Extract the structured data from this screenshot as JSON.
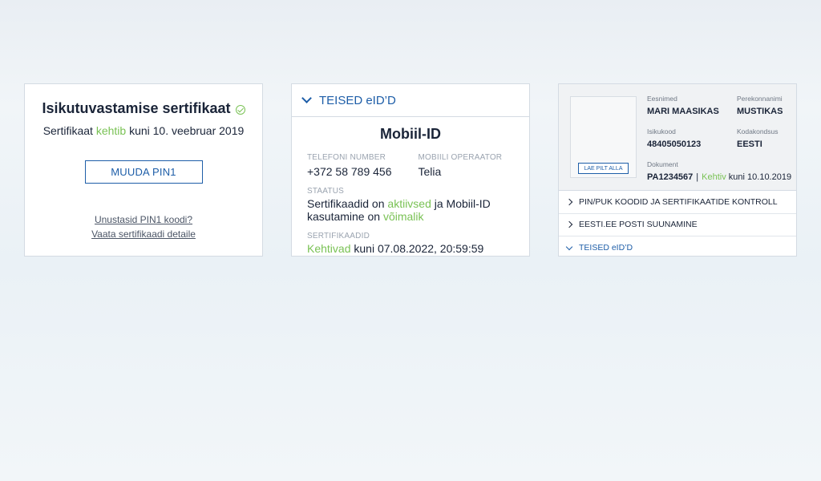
{
  "cert_card": {
    "title": "Isikutuvastamise sertifikaat",
    "status_prefix": "Sertifikaat",
    "status_word": "kehtib",
    "status_suffix": "kuni 10. veebruar 2019",
    "change_pin_button": "MUUDA PIN1",
    "forgot_pin_link": "Unustasid PIN1 koodi?",
    "details_link": "Vaata sertifikaadi detaile"
  },
  "mobile_card": {
    "header": "TEISED eID’D",
    "title": "Mobiil-ID",
    "phone_label": "TELEFONI NUMBER",
    "phone_value": "+372 58 789 456",
    "operator_label": "MOBIILI OPERAATOR",
    "operator_value": "Telia",
    "status_label": "STAATUS",
    "status_text_1": "Sertifikaadid on",
    "status_word_1": "aktiivsed",
    "status_text_2": "ja Mobiil-ID kasutamine on",
    "status_word_2": "võimalik",
    "certs_label": "SERTIFIKAADID",
    "certs_word": "Kehtivad",
    "certs_text": "kuni 07.08.2022, 20:59:59"
  },
  "profile_card": {
    "upload_button": "LAE PILT ALLA",
    "first_name_label": "Eesnimed",
    "first_name_value": "MARI MAASIKAS",
    "last_name_label": "Perekonnanimi",
    "last_name_value": "MUSTIKAS",
    "id_code_label": "Isikukood",
    "id_code_value": "48405050123",
    "citizenship_label": "Kodakondsus",
    "citizenship_value": "EESTI",
    "document_label": "Dokument",
    "document_number": "PA1234567",
    "document_separator": "|",
    "document_status": "Kehtiv",
    "document_valid_until": "kuni 10.10.2019",
    "menu": [
      {
        "label": "PIN/PUK KOODID JA SERTIFIKAATIDE KONTROLL"
      },
      {
        "label": "EESTI.EE POSTI SUUNAMINE"
      },
      {
        "label": "TEISED eID’D"
      }
    ]
  },
  "colors": {
    "accent": "#1e5ea8",
    "valid_green": "#7ac255",
    "text": "#1a2438"
  }
}
